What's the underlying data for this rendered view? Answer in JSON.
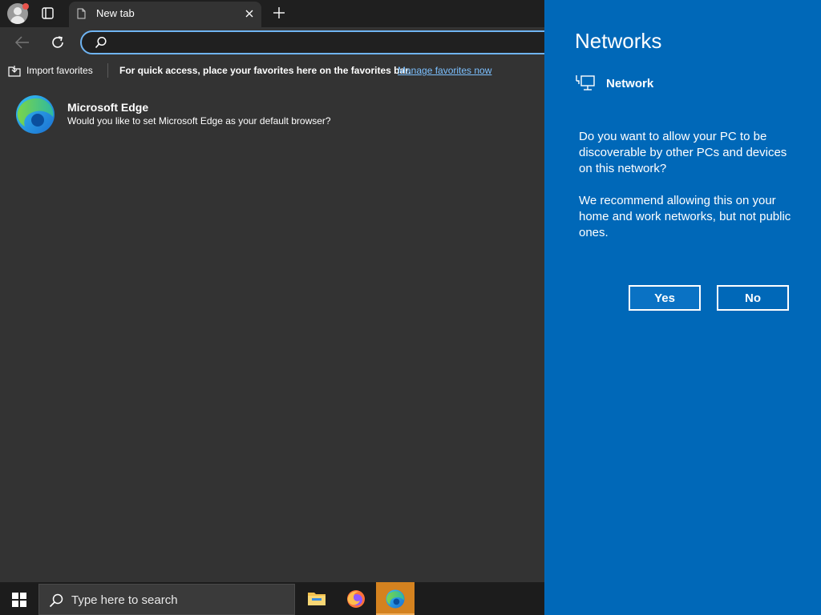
{
  "browser": {
    "tab": {
      "title": "New tab"
    },
    "address_bar": {
      "value": "",
      "placeholder": ""
    },
    "favorites_bar": {
      "import_label": "Import favorites",
      "message": "For quick access, place your favorites here on the favorites bar.",
      "manage_link": "Manage favorites now"
    },
    "default_notice": {
      "title": "Microsoft Edge",
      "text": "Would you like to set Microsoft Edge as your default browser?"
    }
  },
  "taskbar": {
    "search_placeholder": "Type here to search",
    "pinned_apps": [
      "file-explorer",
      "firefox",
      "microsoft-edge"
    ],
    "active_app": "microsoft-edge"
  },
  "networks_flyout": {
    "title": "Networks",
    "network_name": "Network",
    "question": "Do you want to allow your PC to be discoverable by other PCs and devices on this network?",
    "recommendation": "We recommend allowing this on your home and work networks, but not public ones.",
    "yes_label": "Yes",
    "no_label": "No"
  },
  "colors": {
    "flyout_background": "#0068b8",
    "browser_background": "#333333",
    "accent_outline": "#6fb4f2",
    "link": "#7cc0ff",
    "active_taskbar_app": "#d4821f"
  }
}
